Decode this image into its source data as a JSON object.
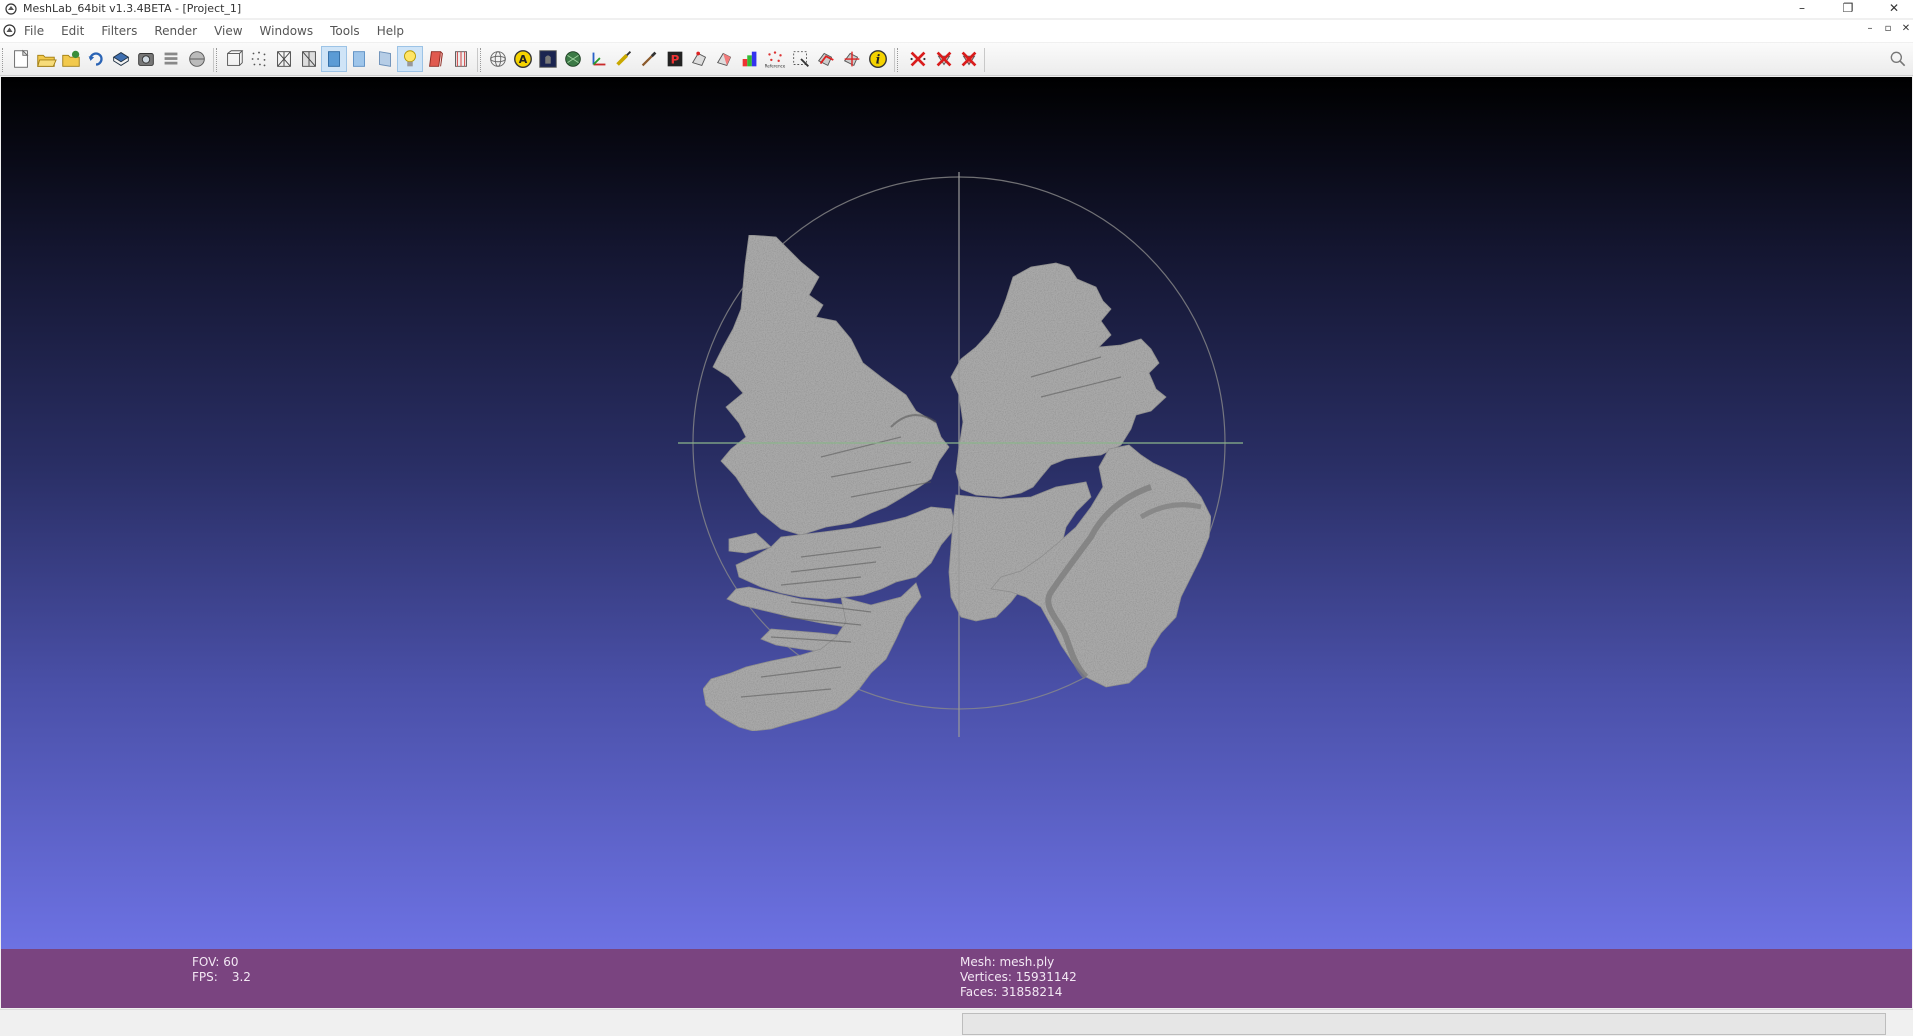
{
  "window": {
    "title": "MeshLab_64bit v1.3.4BETA - [Project_1]",
    "controls": {
      "minimize": "–",
      "restore": "❐",
      "close": "✕"
    }
  },
  "menubar": {
    "items": [
      "File",
      "Edit",
      "Filters",
      "Render",
      "View",
      "Windows",
      "Tools",
      "Help"
    ],
    "mdi_controls": {
      "minimize": "–",
      "restore": "▫",
      "close": "✕"
    }
  },
  "toolbar": {
    "buttons": [
      {
        "name": "new-project-icon",
        "active": false
      },
      {
        "name": "open-project-icon",
        "active": false
      },
      {
        "name": "import-mesh-icon",
        "active": false
      },
      {
        "name": "reload-icon",
        "active": false
      },
      {
        "name": "save-icon",
        "active": false
      },
      {
        "name": "snapshot-icon",
        "active": false
      },
      {
        "name": "layers-icon",
        "active": false
      },
      {
        "name": "raster-icon",
        "active": false
      },
      {
        "name": "bounding-box-icon",
        "active": false
      },
      {
        "name": "points-icon",
        "active": false
      },
      {
        "name": "wireframe-icon",
        "active": false
      },
      {
        "name": "hidden-lines-icon",
        "active": false
      },
      {
        "name": "flat-shading-icon",
        "active": true
      },
      {
        "name": "smooth-shading-icon",
        "active": false
      },
      {
        "name": "texture-icon",
        "active": false
      },
      {
        "name": "light-icon",
        "active": true
      },
      {
        "name": "double-side-lighting-icon",
        "active": false
      },
      {
        "name": "fancy-lighting-icon",
        "active": false
      },
      {
        "name": "trackball-icon",
        "active": false
      },
      {
        "name": "annotation-icon",
        "active": false
      },
      {
        "name": "render-mode-icon",
        "active": false
      },
      {
        "name": "color-sphere-icon",
        "active": false
      },
      {
        "name": "axes-icon",
        "active": false
      },
      {
        "name": "measure-tool-icon",
        "active": false
      },
      {
        "name": "paint-brush-icon",
        "active": false
      },
      {
        "name": "pick-points-icon",
        "active": false
      },
      {
        "name": "select-vertices-icon",
        "active": false
      },
      {
        "name": "select-faces-icon",
        "active": false
      },
      {
        "name": "quality-mapper-icon",
        "active": false
      },
      {
        "name": "reference-icon",
        "active": false
      },
      {
        "name": "select-connected-icon",
        "active": false
      },
      {
        "name": "align-icon",
        "active": false
      },
      {
        "name": "manipulator-icon",
        "active": false
      },
      {
        "name": "info-icon",
        "active": false
      },
      {
        "name": "delete-vertices-icon",
        "active": false
      },
      {
        "name": "delete-faces-icon",
        "active": false
      },
      {
        "name": "delete-selection-icon",
        "active": false
      }
    ],
    "search_icon": "search-icon"
  },
  "info": {
    "fov_label": "FOV: 60",
    "fps_label": "FPS:",
    "fps_value": "3.2",
    "mesh_label": "Mesh: mesh.ply",
    "vertices_label": "Vertices: 15931142",
    "faces_label": "Faces: 31858214"
  },
  "colors": {
    "info_bar": "#7a4480",
    "mesh": "#a9a9a9",
    "trackball": "#8a8a8a"
  }
}
